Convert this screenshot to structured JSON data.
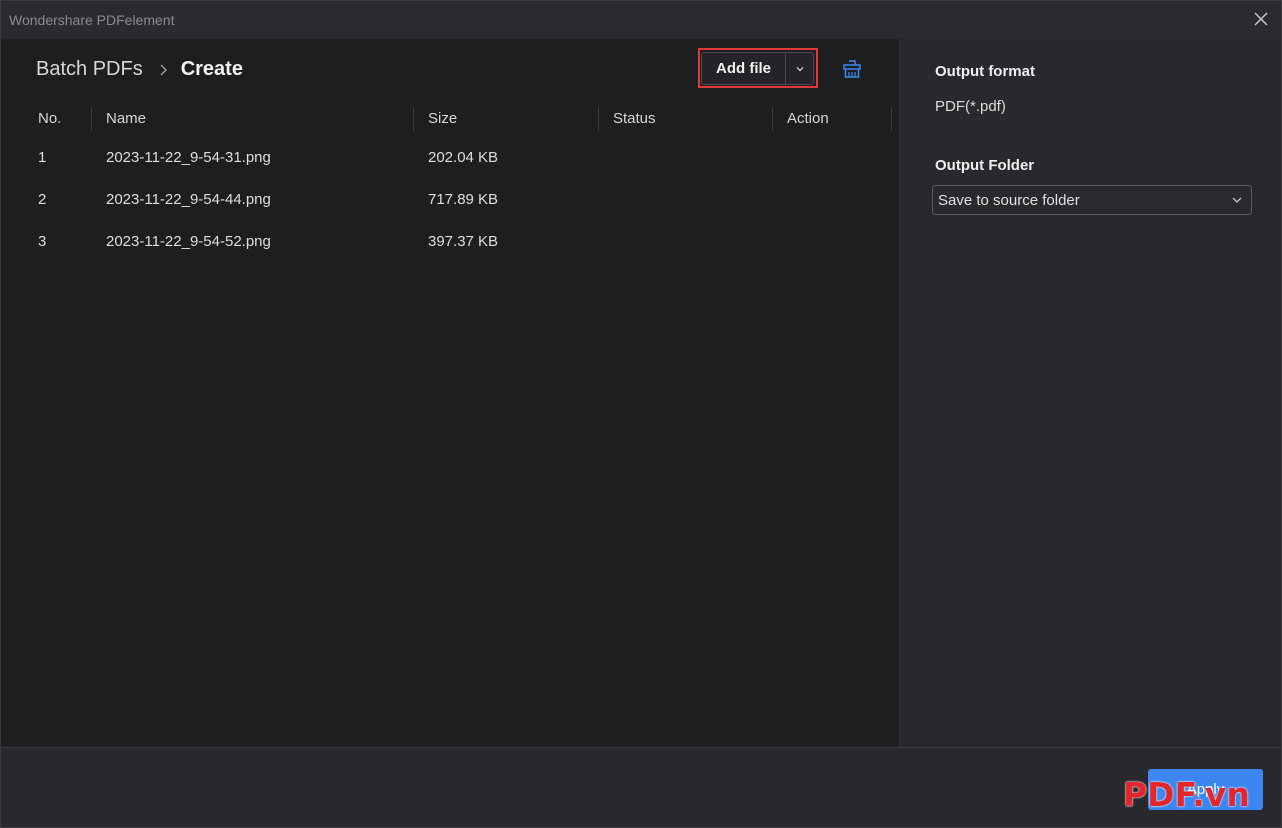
{
  "window": {
    "title": "Wondershare PDFelement"
  },
  "breadcrumb": {
    "parent": "Batch PDFs",
    "current": "Create"
  },
  "toolbar": {
    "add_file_label": "Add file"
  },
  "table": {
    "headers": {
      "no": "No.",
      "name": "Name",
      "size": "Size",
      "status": "Status",
      "action": "Action"
    },
    "rows": [
      {
        "no": "1",
        "name": "2023-11-22_9-54-31.png",
        "size": "202.04 KB",
        "status": "",
        "action": ""
      },
      {
        "no": "2",
        "name": "2023-11-22_9-54-44.png",
        "size": "717.89 KB",
        "status": "",
        "action": ""
      },
      {
        "no": "3",
        "name": "2023-11-22_9-54-52.png",
        "size": "397.37 KB",
        "status": "",
        "action": ""
      }
    ]
  },
  "side_panel": {
    "output_format_label": "Output format",
    "output_format_value": "PDF(*.pdf)",
    "output_folder_label": "Output Folder",
    "output_folder_value": "Save to source folder"
  },
  "footer": {
    "apply_label": "Apply",
    "watermark": "PDF.vn"
  },
  "colors": {
    "accent": "#3b86f0",
    "highlight": "#e0383b",
    "background": "#1e1e21",
    "panel": "#29292d"
  },
  "icons": {
    "close": "close-icon",
    "breadcrumb_separator": "chevron-right-icon",
    "dropdown": "chevron-down-icon",
    "clear": "clear-list-icon"
  }
}
